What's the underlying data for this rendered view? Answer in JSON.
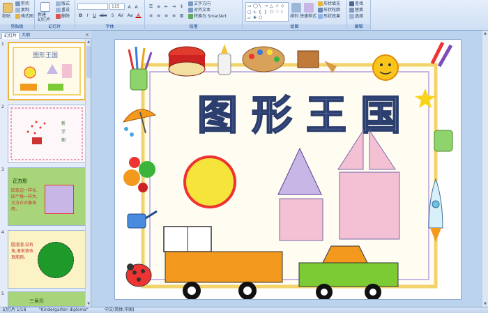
{
  "ribbon": {
    "clipboard": {
      "label": "剪贴板",
      "paste": "粘贴",
      "cut": "剪切",
      "copy": "复制",
      "format_painter": "格式刷"
    },
    "slides": {
      "label": "幻灯片",
      "new_slide": "新建\n幻灯片",
      "layout": "版式",
      "reset": "重设",
      "delete": "删除"
    },
    "font": {
      "label": "字体",
      "font_name": "",
      "font_size": "115",
      "bold": "B",
      "italic": "I",
      "underline": "U",
      "strike": "abc",
      "shadow": "S",
      "spacing": "AV",
      "case": "Aa",
      "color": "A"
    },
    "paragraph": {
      "label": "段落",
      "text_direction": "文字方向",
      "align_text": "对齐文本",
      "smartart": "转换为 SmartArt"
    },
    "drawing": {
      "label": "绘图",
      "arrange": "排列",
      "quick_styles": "快速样式",
      "shape_fill": "形状填充",
      "shape_outline": "形状轮廓",
      "shape_effects": "形状效果"
    },
    "editing": {
      "label": "编辑",
      "find": "查找",
      "replace": "替换",
      "select": "选择"
    }
  },
  "pane": {
    "tab_slides": "幻灯片",
    "tab_outline": "大纲",
    "close": "×",
    "slides": [
      {
        "num": "1",
        "selected": true
      },
      {
        "num": "2",
        "selected": false
      },
      {
        "num": "3",
        "selected": false,
        "text": "四条边一样长,四个角一样大,方方正正像块砖。",
        "title": "正方形"
      },
      {
        "num": "4",
        "selected": false,
        "text": "圆溜溜,没有角,滚来滚去真能跑。"
      },
      {
        "num": "5",
        "selected": false,
        "title": "三角形"
      }
    ]
  },
  "slide": {
    "title": "图形王国"
  },
  "status": {
    "slide_count": "幻灯片 1/18",
    "theme": "\"Kindergarten diploma\"",
    "language": "中文(简体,中国)"
  },
  "colors": {
    "ribbon_bg": "#dbe7f7",
    "circle": "#f5e53a",
    "triangle": "#c8b7e6",
    "pink": "#f4c0d4",
    "truck_body": "#f39a1e",
    "car_body": "#7ccb35"
  }
}
